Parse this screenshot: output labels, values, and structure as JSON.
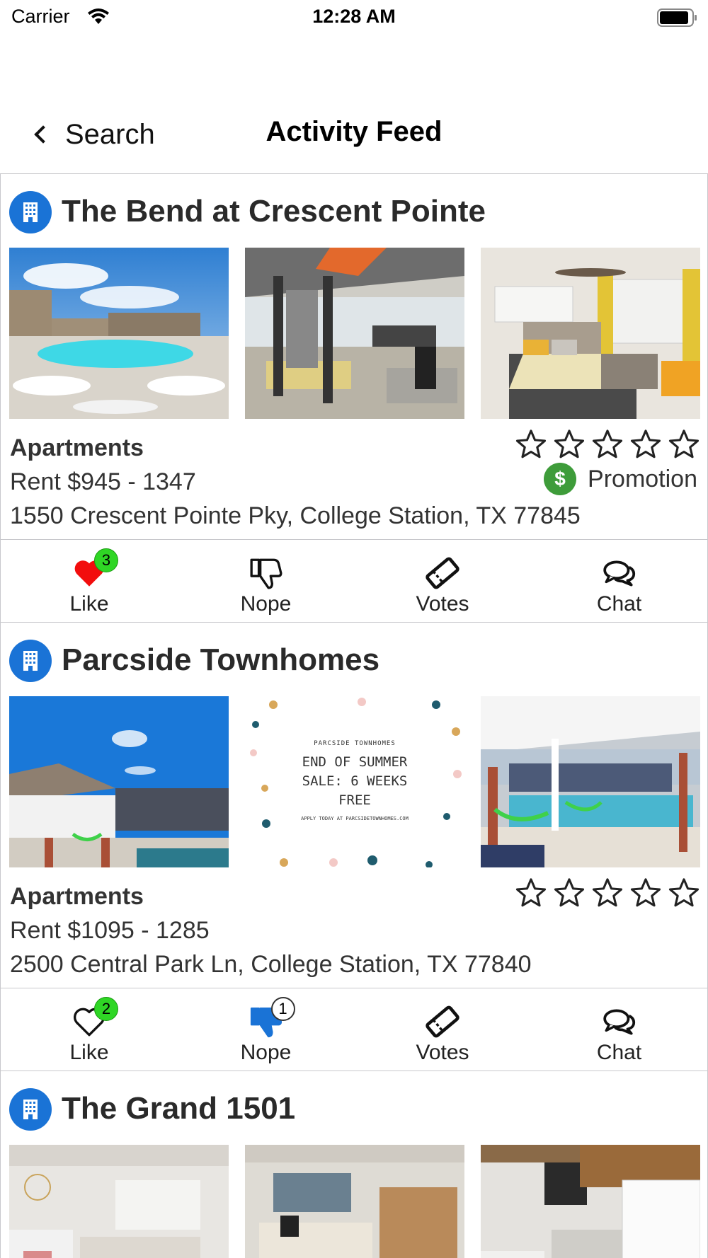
{
  "status_bar": {
    "carrier": "Carrier",
    "time": "12:28 AM"
  },
  "nav": {
    "back_label": "Search",
    "title": "Activity Feed"
  },
  "listings": [
    {
      "name": "The Bend at Crescent Pointe",
      "type": "Apartments",
      "rent": "Rent $945 - 1347",
      "address": "1550 Crescent Pointe Pky, College Station, TX 77845",
      "rating": 0,
      "promotion": {
        "symbol": "$",
        "label": "Promotion"
      },
      "photos": [
        "pool",
        "gym",
        "bedroom"
      ],
      "actions": {
        "like": "Like",
        "nope": "Nope",
        "votes": "Votes",
        "chat": "Chat"
      },
      "like_count": "3",
      "liked": true
    },
    {
      "name": "Parcside Townhomes",
      "type": "Apartments",
      "rent": "Rent $1095 - 1285",
      "address": "2500 Central Park Ln, College Station, TX 77840",
      "rating": 0,
      "photos": [
        "pergola",
        "promo-flyer",
        "pool-hammocks"
      ],
      "flyer": {
        "brand": "PARCSIDE TOWNHOMES",
        "line1": "END OF SUMMER",
        "line2": "SALE: 6 WEEKS",
        "line3": "FREE",
        "footer": "APPLY TODAY AT PARCSIDETOWNHOMES.COM"
      },
      "actions": {
        "like": "Like",
        "nope": "Nope",
        "votes": "Votes",
        "chat": "Chat"
      },
      "like_count": "2",
      "nope_count": "1",
      "noped": true
    },
    {
      "name": "The Grand 1501",
      "photos": [
        "bedroom-kitchen",
        "living-room",
        "kitchen"
      ]
    }
  ],
  "colors": {
    "brand_blue": "#1a73d6",
    "promo_green": "#3e9c3a",
    "badge_green": "#2fd625",
    "like_red": "#f20d0d",
    "nope_blue": "#1a73d6"
  },
  "icons": [
    "wifi-icon",
    "battery-icon",
    "chevron-left-icon",
    "building-icon",
    "star-icon",
    "dollar-icon",
    "heart-icon",
    "thumbs-down-icon",
    "ticket-icon",
    "chat-bubbles-icon"
  ]
}
